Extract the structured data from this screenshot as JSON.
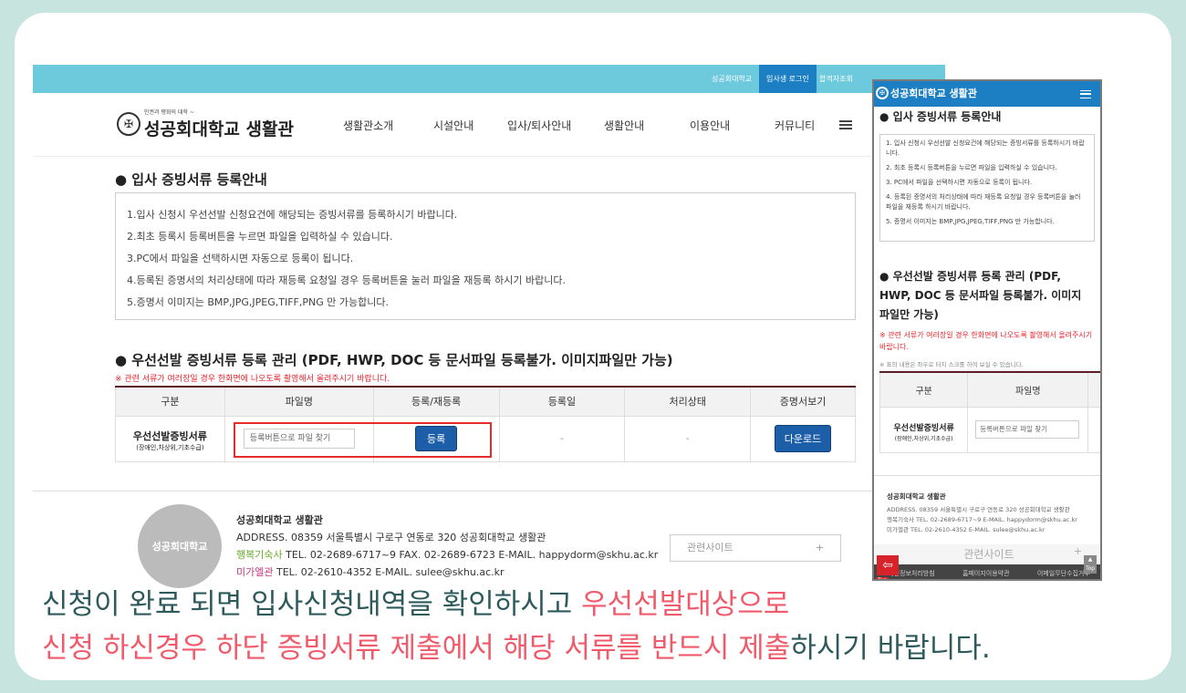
{
  "desktop": {
    "topbar": {
      "univ": "성공회대학교",
      "login": "입사생 로그인",
      "result": "합격자조회"
    },
    "logo": {
      "sub": "인권과 평화의 대학 ~",
      "name": "성공회대학교 생활관"
    },
    "menu": [
      "생활관소개",
      "시설안내",
      "입사/퇴사안내",
      "생활안내",
      "이용안내",
      "커뮤니티"
    ],
    "section1_title": "● 입사 증빙서류 등록안내",
    "notices": [
      "1.입사 신청시 우선선발 신청요건에 해당되는 증빙서류를 등록하시기 바랍니다.",
      "2.최초 등록시 등록버튼을 누르면 파일을 입력하실 수 있습니다.",
      "3.PC에서 파일을 선택하시면 자동으로 등록이 됩니다.",
      "4.등록된 증명서의 처리상태에 따라 재등록 요청일 경우 등록버튼을 눌러 파일을 재등록 하시기 바랍니다.",
      "5.증명서 이미지는 BMP,JPG,JPEG,TIFF,PNG 만 가능합니다."
    ],
    "section2_title": "● 우선선발 증빙서류 등록 관리 (PDF, HWP, DOC 등 문서파일 등록불가. 이미지파일만 가능)",
    "warning": "※ 관련 서류가 여러장일 경우 한화면에 나오도록 촬영해서 올려주시기 바랍니다.",
    "table": {
      "headers": [
        "구분",
        "파일명",
        "등록/재등록",
        "등록일",
        "처리상태",
        "증명서보기"
      ],
      "row": {
        "name": "우선선발증빙서류",
        "sub": "(장애인,차상위,기초수급)",
        "file_placeholder": "등록버튼으로 파일 찾기",
        "register": "등록",
        "date": "-",
        "status": "-",
        "download": "다운로드"
      }
    },
    "footer": {
      "seal": "성공회대학교",
      "title": "성공회대학교 생활관",
      "address": "ADDRESS. 08359 서울특별시 구로구 연동로 320 성공회대학교 생활관",
      "dorm1_name": "행복기숙사",
      "dorm1_info": "TEL. 02-2689-6717~9  FAX. 02-2689-6723  E-MAIL. happydorm@skhu.ac.kr",
      "dorm2_name": "미가엘관",
      "dorm2_info": "TEL. 02-2610-4352  E-MAIL. sulee@skhu.ac.kr",
      "related": "관련사이트",
      "plus": "+"
    }
  },
  "mobile": {
    "logo": "성공회대학교 생활관",
    "section1_title": "● 입사 증빙서류 등록안내",
    "notices": [
      "1. 입사 신청시 우선선발 신청요건에 해당되는 증빙서류를 등록하시기 바랍니다.",
      "2. 최초 등록시 등록버튼을 누르면 파일을 입력하실 수 있습니다.",
      "3. PC에서 파일을 선택하시면 자동으로 등록이 됩니다.",
      "4. 등록된 증명서의 처리상태에 따라 재등록 요청일 경우 등록버튼을 눌러 파일을 재등록 하시기 바랍니다.",
      "5. 증명서 이미지는 BMP,JPG,JPEG,TIFF,PNG 만 가능합니다."
    ],
    "section2_title": "● 우선선발 증빙서류 등록 관리 (PDF, HWP, DOC 등 문서파일 등록불가. 이미지파일만 가능)",
    "warning": "※ 관련 서류가 여러장일 경우 한화면에 나오도록 촬영해서 올려주시기 바랍니다.",
    "scroll_note": "※ 표의 내용은 좌우로 터치 스크롤 하여 보실 수 있습니다.",
    "headers": [
      "구분",
      "파일명"
    ],
    "row_name": "우선선발증빙서류",
    "row_sub": "(장애인,차상위,기초수급)",
    "file_placeholder": "등록버튼으로 파일 찾기",
    "footer_title": "성공회대학교 생활관",
    "footer_lines": [
      "ADDRESS. 08359 서울특별시 구로구 연동로 320 성공회대학교 생활관",
      "행복기숙사  TEL. 02-2689-6717~9  E-MAIL. happydorm@skhu.ac.kr",
      "미가엘관  TEL. 02-2610-4352  E-MAIL. sulee@skhu.ac.kr"
    ],
    "related": "관련사이트",
    "top": "Top",
    "bottom_links": [
      "개인정보처리방침",
      "홈페이지이용약관",
      "이메일무단수집거부"
    ]
  },
  "caption": {
    "line1_a": "신청이 완료 되면 입사신청내역을 확인하시고 ",
    "line1_b": "우선선발대상으로",
    "line2_a": "신청 하신경우 하단 증빙서류 제출에서 해당 서류를 반드시 제출",
    "line2_b": "하시기 바랍니다."
  },
  "colors": {
    "background": "#c8e4df",
    "topbar": "#6dc9dc",
    "accent_blue": "#1c5ea8",
    "warning_red": "#e8262f",
    "caption_dark": "#2e5a5c",
    "caption_pink": "#f05a6a"
  }
}
